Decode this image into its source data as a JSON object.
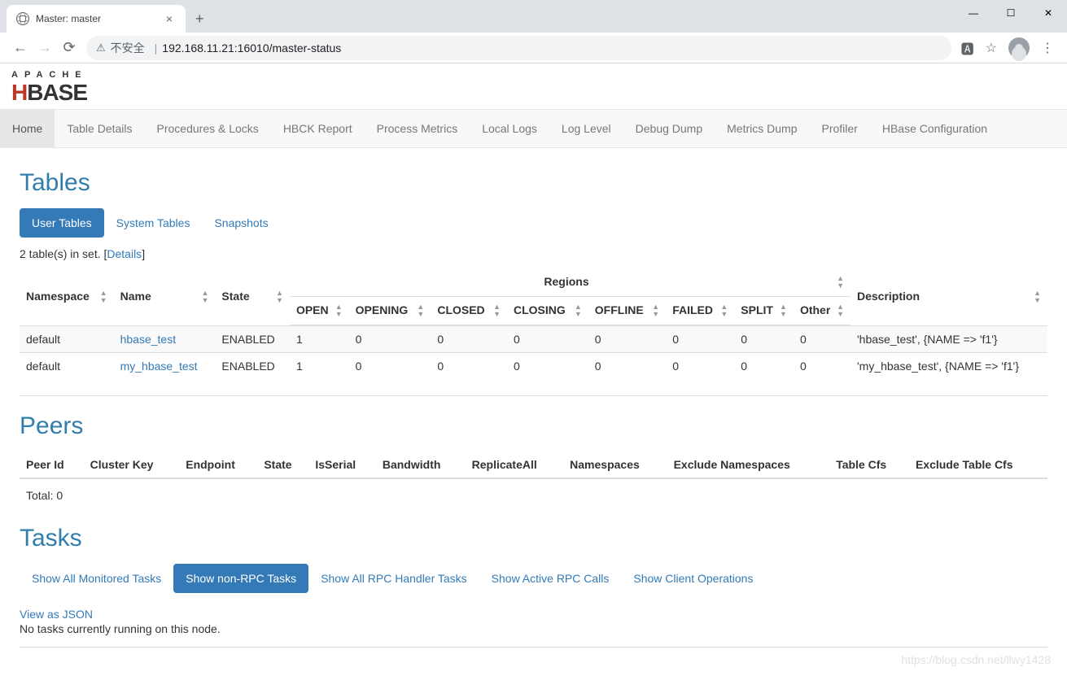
{
  "browser": {
    "tab_title": "Master: master",
    "insecure_label": "不安全",
    "url": "192.168.11.21:16010/master-status"
  },
  "logo": {
    "apache": "APACHE",
    "hbase_h": "H",
    "hbase_rest": "BASE"
  },
  "navbar": [
    "Home",
    "Table Details",
    "Procedures & Locks",
    "HBCK Report",
    "Process Metrics",
    "Local Logs",
    "Log Level",
    "Debug Dump",
    "Metrics Dump",
    "Profiler",
    "HBase Configuration"
  ],
  "tables": {
    "heading": "Tables",
    "tabs": [
      "User Tables",
      "System Tables",
      "Snapshots"
    ],
    "summary_prefix": "2 table(s) in set. [",
    "summary_link": "Details",
    "summary_suffix": "]",
    "columns": {
      "namespace": "Namespace",
      "name": "Name",
      "state": "State",
      "regions": "Regions",
      "open": "OPEN",
      "opening": "OPENING",
      "closed": "CLOSED",
      "closing": "CLOSING",
      "offline": "OFFLINE",
      "failed": "FAILED",
      "split": "SPLIT",
      "other": "Other",
      "description": "Description"
    },
    "rows": [
      {
        "namespace": "default",
        "name": "hbase_test",
        "state": "ENABLED",
        "open": "1",
        "opening": "0",
        "closed": "0",
        "closing": "0",
        "offline": "0",
        "failed": "0",
        "split": "0",
        "other": "0",
        "desc": "'hbase_test', {NAME => 'f1'}"
      },
      {
        "namespace": "default",
        "name": "my_hbase_test",
        "state": "ENABLED",
        "open": "1",
        "opening": "0",
        "closed": "0",
        "closing": "0",
        "offline": "0",
        "failed": "0",
        "split": "0",
        "other": "0",
        "desc": "'my_hbase_test', {NAME => 'f1'}"
      }
    ]
  },
  "peers": {
    "heading": "Peers",
    "columns": [
      "Peer Id",
      "Cluster Key",
      "Endpoint",
      "State",
      "IsSerial",
      "Bandwidth",
      "ReplicateAll",
      "Namespaces",
      "Exclude Namespaces",
      "Table Cfs",
      "Exclude Table Cfs"
    ],
    "total": "Total: 0"
  },
  "tasks": {
    "heading": "Tasks",
    "tabs": [
      "Show All Monitored Tasks",
      "Show non-RPC Tasks",
      "Show All RPC Handler Tasks",
      "Show Active RPC Calls",
      "Show Client Operations"
    ],
    "json_link": "View as JSON",
    "empty": "No tasks currently running on this node."
  },
  "watermark": "https://blog.csdn.net/llwy1428"
}
